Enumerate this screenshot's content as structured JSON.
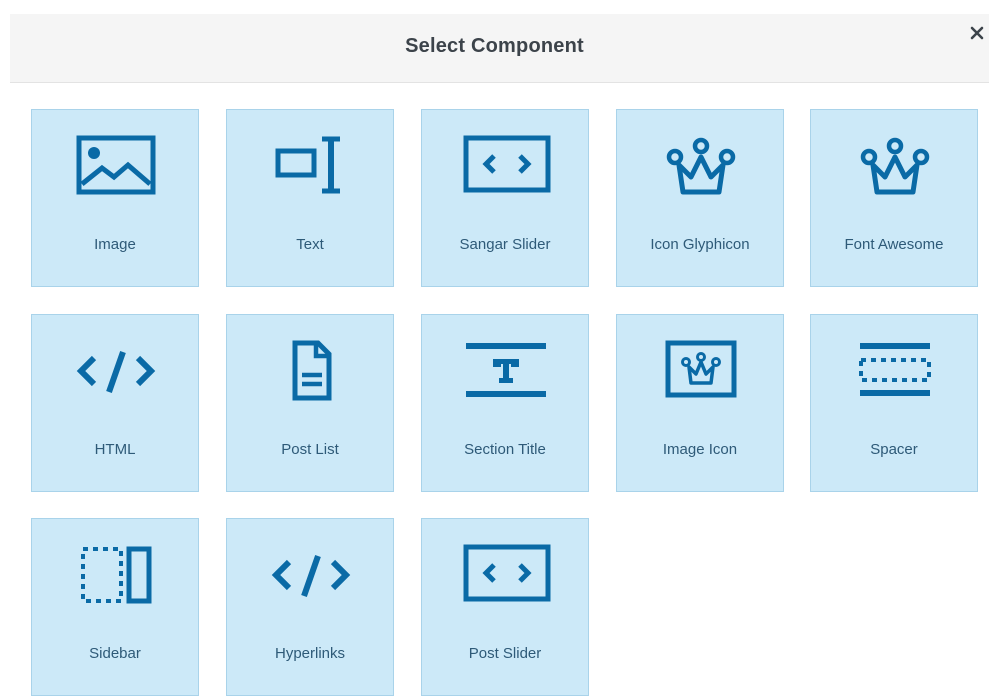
{
  "modal": {
    "title": "Select Component",
    "close_glyph": "×"
  },
  "components": [
    {
      "label": "Image",
      "icon": "image-icon"
    },
    {
      "label": "Text",
      "icon": "text-cursor-icon"
    },
    {
      "label": "Sangar Slider",
      "icon": "slider-icon"
    },
    {
      "label": "Icon Glyphicon",
      "icon": "crown-icon"
    },
    {
      "label": "Font Awesome",
      "icon": "crown-icon"
    },
    {
      "label": "HTML",
      "icon": "code-icon"
    },
    {
      "label": "Post List",
      "icon": "document-icon"
    },
    {
      "label": "Section Title",
      "icon": "section-title-icon"
    },
    {
      "label": "Image Icon",
      "icon": "framed-crown-icon"
    },
    {
      "label": "Spacer",
      "icon": "spacer-icon"
    },
    {
      "label": "Sidebar",
      "icon": "sidebar-icon"
    },
    {
      "label": "Hyperlinks",
      "icon": "code-icon"
    },
    {
      "label": "Post Slider",
      "icon": "slider-icon"
    }
  ],
  "colors": {
    "tile_background": "#cce9f8",
    "tile_border": "#a9d3ea",
    "icon": "#0a6aa6",
    "label_text": "#2e5a78",
    "header_background": "#f5f5f5"
  }
}
